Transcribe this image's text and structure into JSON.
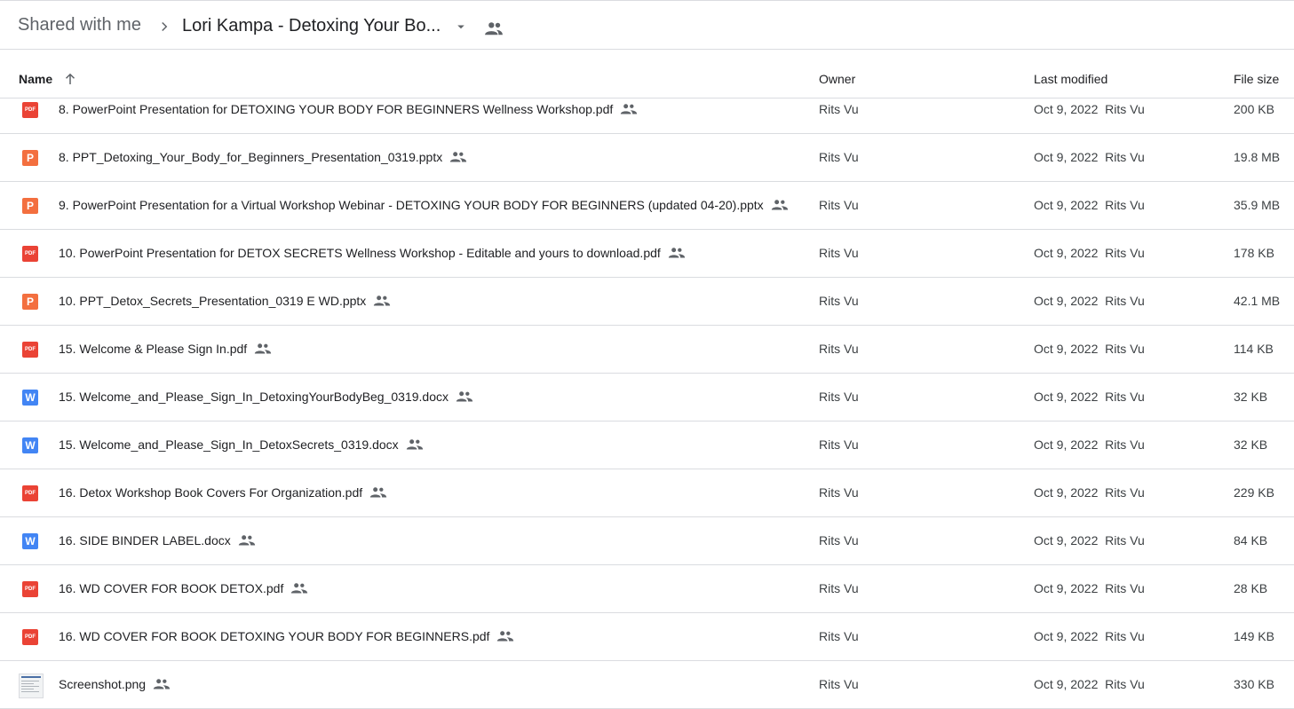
{
  "breadcrumb": {
    "root": "Shared with me",
    "current": "Lori Kampa - Detoxing Your Bo..."
  },
  "columns": {
    "name": "Name",
    "owner": "Owner",
    "last_modified": "Last modified",
    "file_size": "File size"
  },
  "icons": {
    "pdf_label": "PDF",
    "pptx_label": "P",
    "docx_label": "W"
  },
  "colors": {
    "pdf": "#ea4335",
    "pptx": "#f36f3f",
    "docx": "#4285f4"
  },
  "files": [
    {
      "name": "8. PowerPoint Presentation for DETOXING YOUR BODY FOR BEGINNERS Wellness Workshop.pdf",
      "type": "pdf",
      "owner": "Rits Vu",
      "modified": "Oct 9, 2022  Rits Vu",
      "size": "200 KB"
    },
    {
      "name": "8. PPT_Detoxing_Your_Body_for_Beginners_Presentation_0319.pptx",
      "type": "pptx",
      "owner": "Rits Vu",
      "modified": "Oct 9, 2022  Rits Vu",
      "size": "19.8 MB"
    },
    {
      "name": "9. PowerPoint Presentation for a Virtual Workshop Webinar - DETOXING YOUR BODY FOR BEGINNERS (updated 04-20).pptx",
      "type": "pptx",
      "owner": "Rits Vu",
      "modified": "Oct 9, 2022  Rits Vu",
      "size": "35.9 MB"
    },
    {
      "name": "10. PowerPoint Presentation for DETOX SECRETS Wellness Workshop - Editable and yours to download.pdf",
      "type": "pdf",
      "owner": "Rits Vu",
      "modified": "Oct 9, 2022  Rits Vu",
      "size": "178 KB"
    },
    {
      "name": "10. PPT_Detox_Secrets_Presentation_0319 E WD.pptx",
      "type": "pptx",
      "owner": "Rits Vu",
      "modified": "Oct 9, 2022  Rits Vu",
      "size": "42.1 MB"
    },
    {
      "name": "15. Welcome & Please Sign In.pdf",
      "type": "pdf",
      "owner": "Rits Vu",
      "modified": "Oct 9, 2022  Rits Vu",
      "size": "114 KB"
    },
    {
      "name": "15. Welcome_and_Please_Sign_In_DetoxingYourBodyBeg_0319.docx",
      "type": "docx",
      "owner": "Rits Vu",
      "modified": "Oct 9, 2022  Rits Vu",
      "size": "32 KB"
    },
    {
      "name": "15. Welcome_and_Please_Sign_In_DetoxSecrets_0319.docx",
      "type": "docx",
      "owner": "Rits Vu",
      "modified": "Oct 9, 2022  Rits Vu",
      "size": "32 KB"
    },
    {
      "name": "16. Detox Workshop Book Covers For Organization.pdf",
      "type": "pdf",
      "owner": "Rits Vu",
      "modified": "Oct 9, 2022  Rits Vu",
      "size": "229 KB"
    },
    {
      "name": "16. SIDE BINDER LABEL.docx",
      "type": "docx",
      "owner": "Rits Vu",
      "modified": "Oct 9, 2022  Rits Vu",
      "size": "84 KB"
    },
    {
      "name": "16. WD COVER FOR BOOK DETOX.pdf",
      "type": "pdf",
      "owner": "Rits Vu",
      "modified": "Oct 9, 2022  Rits Vu",
      "size": "28 KB"
    },
    {
      "name": "16. WD COVER FOR BOOK DETOXING YOUR BODY FOR BEGINNERS.pdf",
      "type": "pdf",
      "owner": "Rits Vu",
      "modified": "Oct 9, 2022  Rits Vu",
      "size": "149 KB"
    },
    {
      "name": "Screenshot.png",
      "type": "png",
      "owner": "Rits Vu",
      "modified": "Oct 9, 2022  Rits Vu",
      "size": "330 KB"
    }
  ]
}
